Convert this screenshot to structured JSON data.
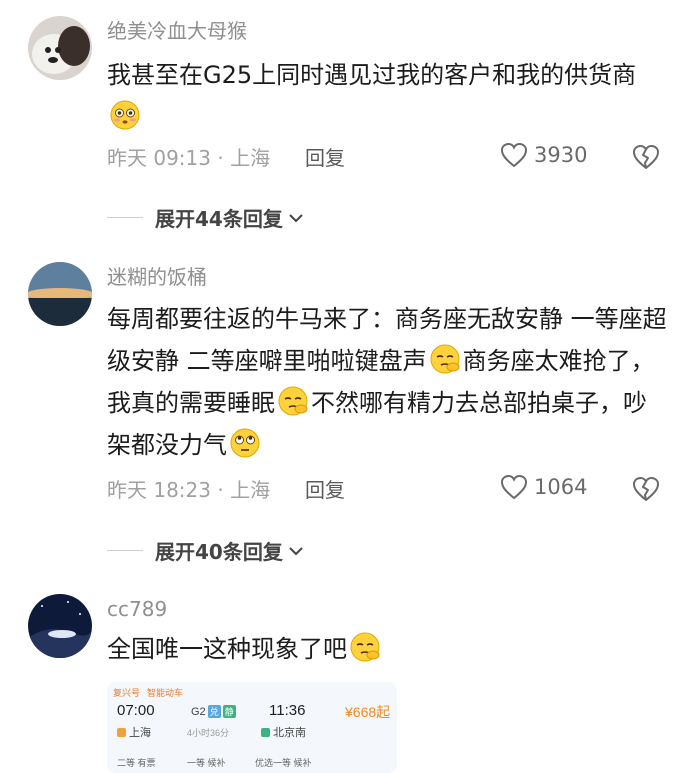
{
  "comments": [
    {
      "username": "绝美冷血大母猴",
      "text": "我甚至在G25上同时遇见过我的客户和我的供货商",
      "emoji": "flushed-face",
      "time_location": "昨天 09:13 · 上海",
      "reply_label": "回复",
      "likes": "3930",
      "expand_label": "展开44条回复"
    },
    {
      "username": "迷糊的饭桶",
      "text_part1": "每周都要往返的牛马来了：商务座无敌安静 一等座超级安静 二等座噼里啪啦键盘声",
      "text_part2": "商务座太难抢了，我真的需要睡眠",
      "text_part3": "不然哪有精力去总部拍桌子，吵架都没力气",
      "time_location": "昨天 18:23 · 上海",
      "reply_label": "回复",
      "likes": "1064",
      "expand_label": "展开40条回复"
    },
    {
      "username": "cc789",
      "text": "全国唯一这种现象了吧",
      "ticket": {
        "tag1": "复兴号",
        "tag2": "智能动车",
        "depart_time": "07:00",
        "train_no": "G2",
        "tag_a": "兑",
        "tag_b": "静",
        "arrive_time": "11:36",
        "price": "¥668起",
        "from_station": "上海",
        "duration": "4小时36分",
        "to_station": "北京南",
        "seat1": "二等 有票",
        "seat2": "一等 候补",
        "seat3": "优选一等 候补"
      }
    }
  ],
  "colors": {
    "accent_orange": "#f08a1c",
    "username_gray": "#8f8f8f"
  }
}
